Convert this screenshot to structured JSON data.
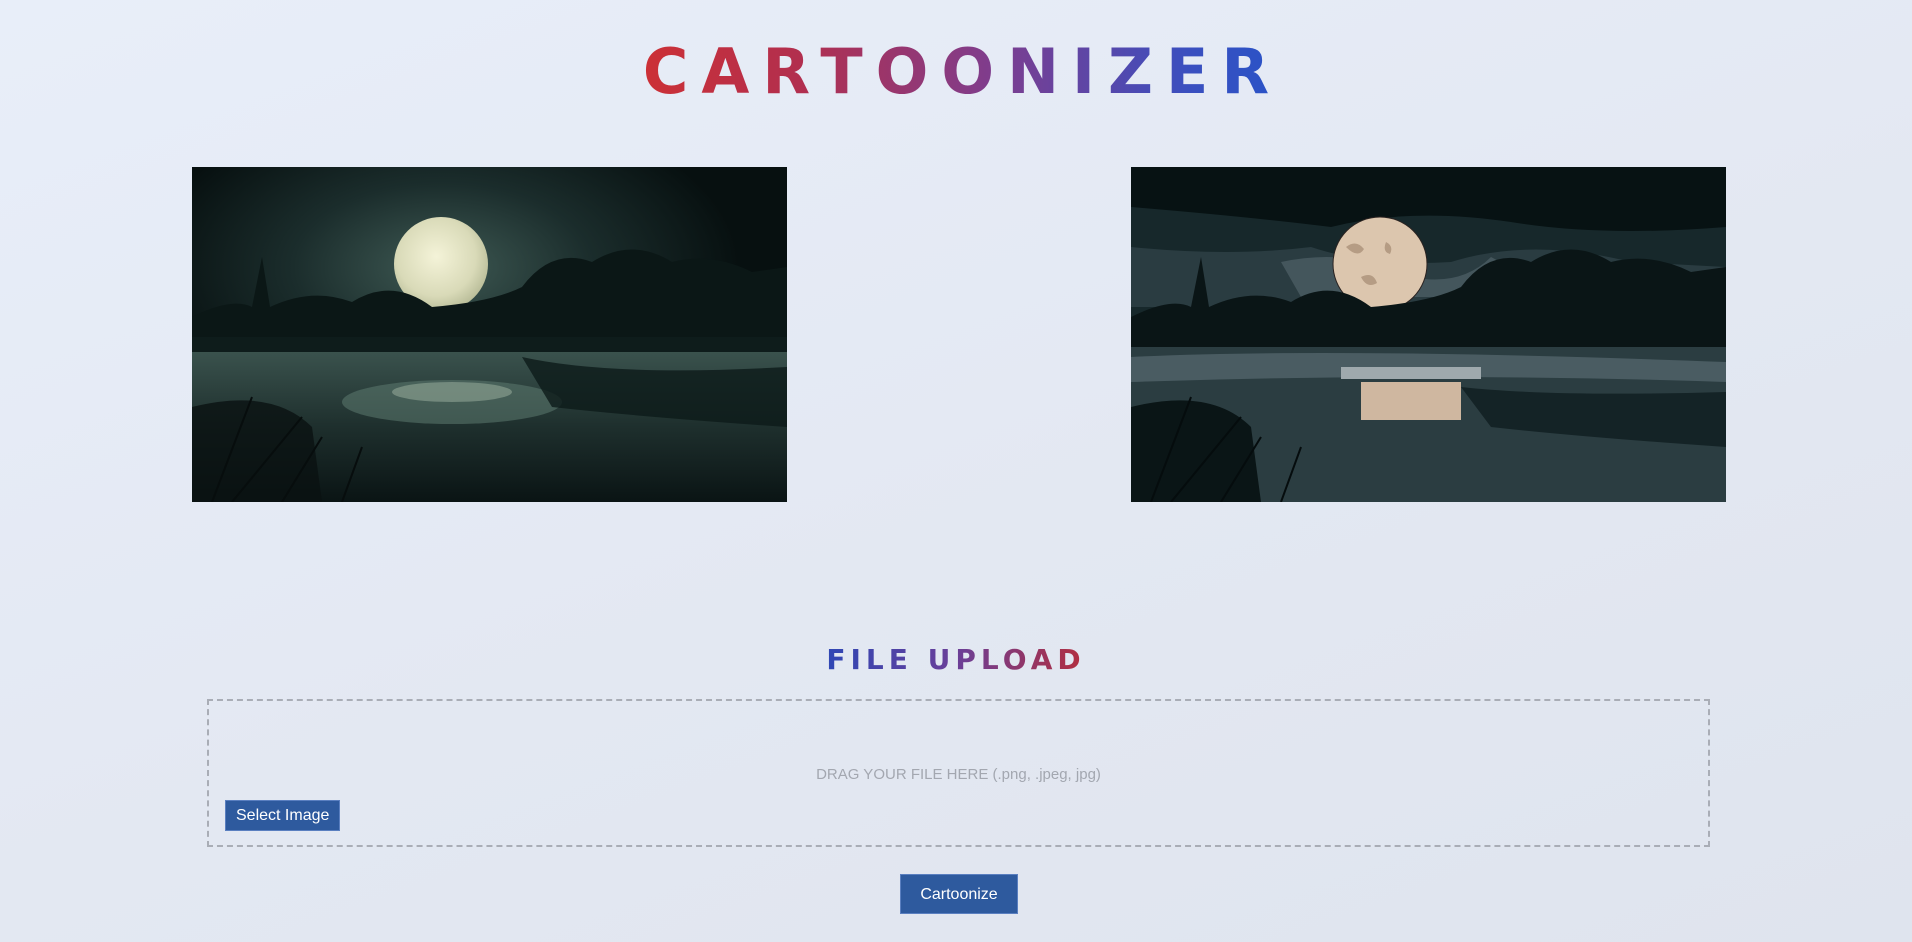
{
  "app": {
    "title": "CARTOONIZER"
  },
  "images": {
    "original": {
      "kind": "moonlit-lake-photo"
    },
    "cartoonized": {
      "kind": "moonlit-lake-cartoon"
    }
  },
  "upload": {
    "heading": "FILE UPLOAD",
    "drop_hint": "DRAG YOUR FILE HERE (.png, .jpeg, jpg)",
    "select_label": "Select Image"
  },
  "actions": {
    "cartoonize_label": "Cartoonize"
  },
  "colors": {
    "button_bg": "#2e5a9e",
    "button_text": "#ffffff",
    "dropzone_border": "#a9adb6",
    "page_bg": "#e4e9f3"
  }
}
